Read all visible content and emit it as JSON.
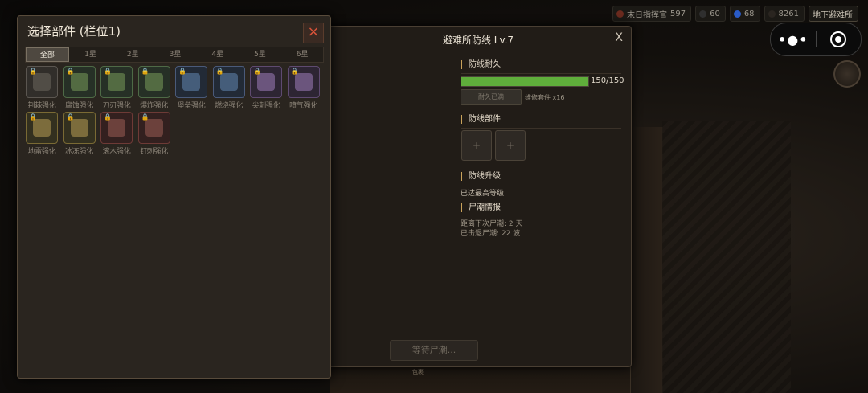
{
  "resources": [
    {
      "label": "末日指挥官",
      "value": "597",
      "color": "#6a2a1e"
    },
    {
      "label": "",
      "value": "60",
      "color": "#2f2f2f"
    },
    {
      "label": "",
      "value": "68",
      "color": "#2a5cc8"
    },
    {
      "label": "",
      "value": "8261",
      "color": "#2a2520"
    },
    {
      "label": "地下避难所",
      "value": "",
      "color": ""
    }
  ],
  "capsule": {
    "more": "•●•"
  },
  "defense": {
    "title": "避难所防线  Lv.7",
    "close": "X",
    "durability": {
      "title": "防线耐久",
      "current": 150,
      "max": 150,
      "text": "150/150",
      "repair_label": "耐久已满",
      "kit_text": "维修套件 x16"
    },
    "parts": {
      "title": "防线部件",
      "slot_symbol": "+"
    },
    "upgrade": {
      "title": "防线升级",
      "status": "已达最高等级"
    },
    "tide": {
      "title": "尸潮情报",
      "next": "距离下次尸潮: 2 天",
      "repelled": "已击退尸潮: 22 波"
    },
    "wait_button": "等待尸潮...",
    "bottom_label": "包裹"
  },
  "parts_panel": {
    "title": "选择部件 (栏位1)",
    "close_symbol": "×",
    "tabs": [
      "全部",
      "1星",
      "2星",
      "3星",
      "4星",
      "5星",
      "6星"
    ],
    "active_tab": 0,
    "items": [
      {
        "label": "荆棘强化",
        "quality": "gray"
      },
      {
        "label": "腐蚀强化",
        "quality": "green"
      },
      {
        "label": "刀刃强化",
        "quality": "green"
      },
      {
        "label": "爆炸强化",
        "quality": "green"
      },
      {
        "label": "堡垒强化",
        "quality": "blue"
      },
      {
        "label": "燃烧强化",
        "quality": "blue"
      },
      {
        "label": "尖刺强化",
        "quality": "purple"
      },
      {
        "label": "喷气强化",
        "quality": "purple"
      },
      {
        "label": "地雷强化",
        "quality": "gold"
      },
      {
        "label": "冰冻强化",
        "quality": "gold"
      },
      {
        "label": "滚木强化",
        "quality": "red"
      },
      {
        "label": "钉刺强化",
        "quality": "red"
      }
    ]
  }
}
